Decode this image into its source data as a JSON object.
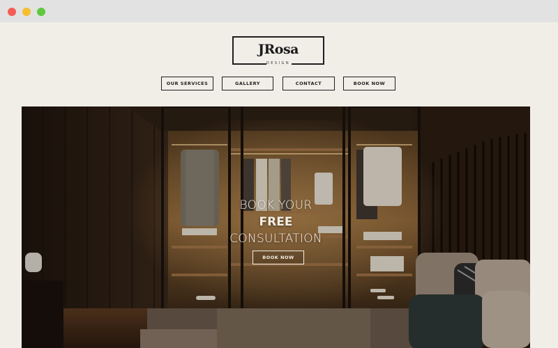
{
  "window": {
    "controls": [
      "close",
      "minimize",
      "maximize"
    ]
  },
  "logo": {
    "title": "JRosa",
    "subtitle": "DESIGN"
  },
  "nav": [
    {
      "label": "OUR SERVICES"
    },
    {
      "label": "GALLERY"
    },
    {
      "label": "CONTACT"
    },
    {
      "label": "BOOK NOW"
    }
  ],
  "hero": {
    "line1": "BOOK YOUR",
    "line2": "FREE",
    "line3": "CONSULTATION",
    "cta": "BOOK NOW",
    "image": "walk-in-closet-bedroom-photo"
  },
  "colors": {
    "background": "#f1eee8",
    "text": "#1b1b1b",
    "hero_text": "#f4efe6",
    "close": "#f45d57",
    "minimize": "#f6be2f",
    "maximize": "#5fc83f"
  }
}
